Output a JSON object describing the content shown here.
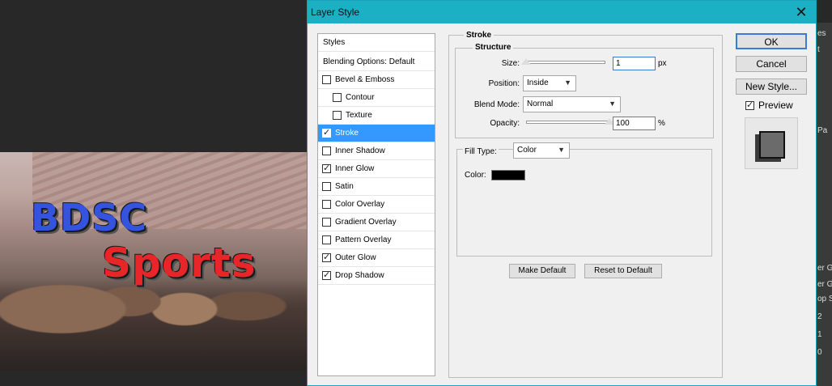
{
  "window": {
    "title": "Layer Style",
    "close_glyph": "✕"
  },
  "canvas": {
    "title_line1": "BDSC",
    "title_line2": "Sports",
    "title_colors": {
      "line1": "#3454e0",
      "line2": "#e8262a"
    }
  },
  "right_strip": {
    "items": [
      "es",
      "t",
      "Pa",
      "er G",
      "er G",
      "op Sh",
      "2",
      "1",
      "0"
    ]
  },
  "styles_list": {
    "header": "Styles",
    "blending": "Blending Options: Default",
    "items": [
      {
        "label": "Bevel & Emboss",
        "checked": false,
        "selected": false,
        "indent": false
      },
      {
        "label": "Contour",
        "checked": false,
        "selected": false,
        "indent": true
      },
      {
        "label": "Texture",
        "checked": false,
        "selected": false,
        "indent": true
      },
      {
        "label": "Stroke",
        "checked": true,
        "selected": true,
        "indent": false
      },
      {
        "label": "Inner Shadow",
        "checked": false,
        "selected": false,
        "indent": false
      },
      {
        "label": "Inner Glow",
        "checked": true,
        "selected": false,
        "indent": false
      },
      {
        "label": "Satin",
        "checked": false,
        "selected": false,
        "indent": false
      },
      {
        "label": "Color Overlay",
        "checked": false,
        "selected": false,
        "indent": false
      },
      {
        "label": "Gradient Overlay",
        "checked": false,
        "selected": false,
        "indent": false
      },
      {
        "label": "Pattern Overlay",
        "checked": false,
        "selected": false,
        "indent": false
      },
      {
        "label": "Outer Glow",
        "checked": true,
        "selected": false,
        "indent": false
      },
      {
        "label": "Drop Shadow",
        "checked": true,
        "selected": false,
        "indent": false
      }
    ]
  },
  "stroke": {
    "group_title": "Stroke",
    "structure_title": "Structure",
    "size_label": "Size:",
    "size_value": "1",
    "size_unit": "px",
    "size_fraction": 0.0,
    "position_label": "Position:",
    "position_value": "Inside",
    "blend_label": "Blend Mode:",
    "blend_value": "Normal",
    "opacity_label": "Opacity:",
    "opacity_value": "100",
    "opacity_unit": "%",
    "opacity_fraction": 1.0,
    "fill_type_label": "Fill Type:",
    "fill_type_value": "Color",
    "color_label": "Color:",
    "color_value": "#000000",
    "make_default": "Make Default",
    "reset_default": "Reset to Default"
  },
  "actions": {
    "ok": "OK",
    "cancel": "Cancel",
    "new_style": "New Style...",
    "preview_label": "Preview",
    "preview_checked": true
  },
  "accent": "#1bb0c4"
}
